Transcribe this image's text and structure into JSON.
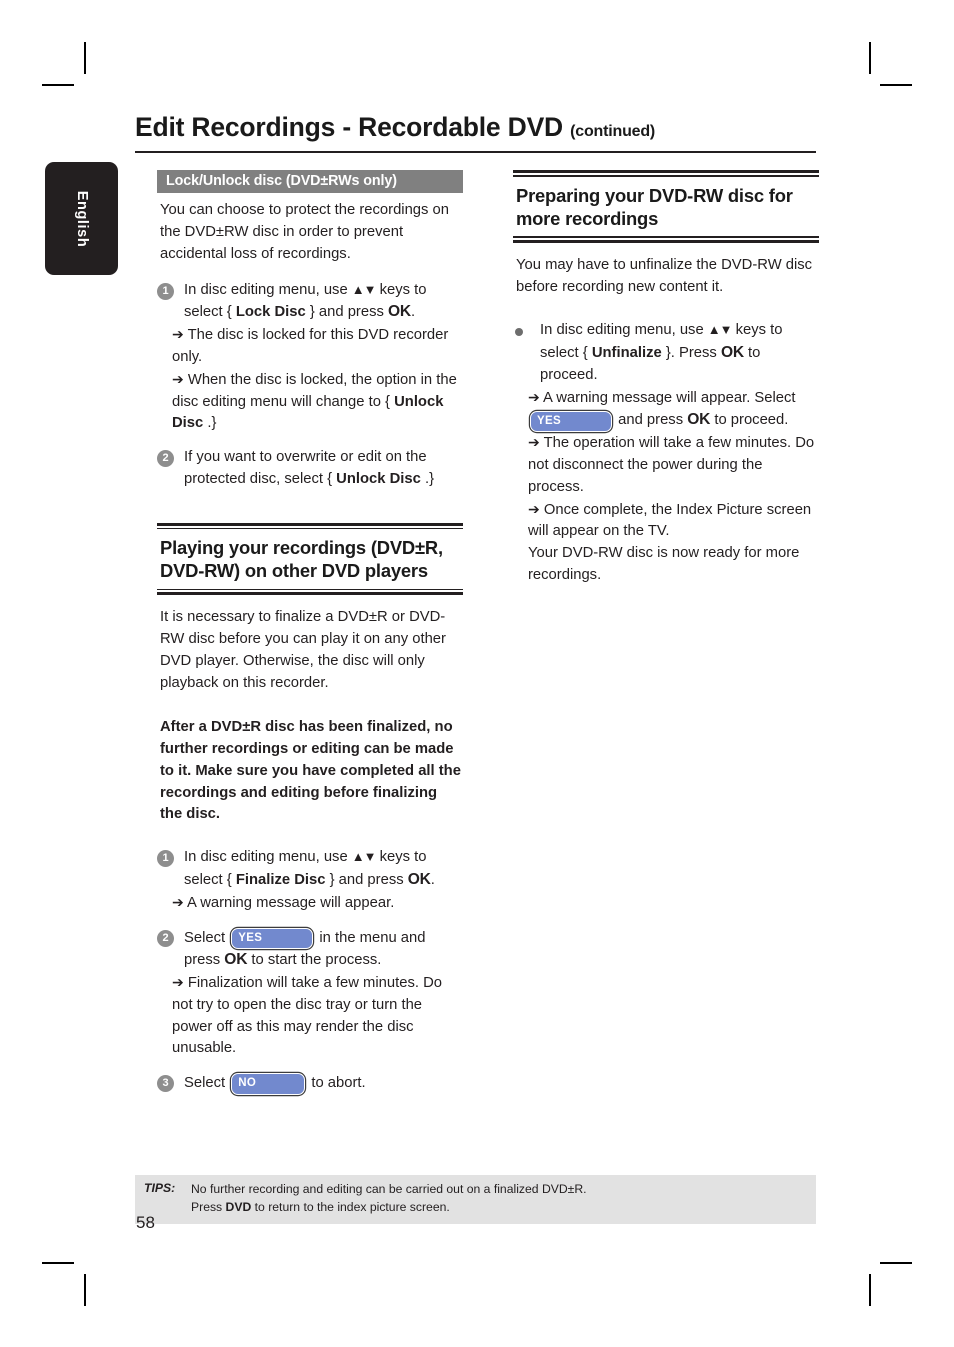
{
  "page": {
    "number": "58",
    "title_main": "Edit Recordings - Recordable DVD",
    "title_suffix": "(continued)",
    "language_tab": "English"
  },
  "left_column": {
    "bar_heading": "Lock/Unlock disc (DVD±RWs only)",
    "intro": "You can choose to protect the recordings on the DVD±RW disc in order to prevent accidental loss of recordings.",
    "steps": [
      {
        "marker": "1",
        "line1_a": "In disc editing menu, use ",
        "line1_keys": "▲▼",
        "line1_b": " keys to select { ",
        "line1_bold": "Lock Disc",
        "line1_c": " } and press ",
        "line1_ok": "OK",
        "line1_d": ".",
        "sub1": "The disc is locked for this DVD recorder only.",
        "sub2_a": "When the disc is locked, the option in the disc editing menu will change to { ",
        "sub2_bold": "Unlock Disc",
        "sub2_b": " .}"
      },
      {
        "marker": "2",
        "text_a": "If you want to overwrite or edit on the protected disc, select { ",
        "text_bold": "Unlock Disc",
        "text_b": " .}"
      }
    ],
    "section2": {
      "heading": "Playing your recordings (DVD±R, DVD-RW) on other DVD players",
      "intro": "It is necessary to finalize a DVD±R or DVD-RW disc before you can play it on any other DVD player. Otherwise, the disc will only playback on this recorder.",
      "warning": "After a DVD±R disc has been finalized, no further recordings or editing can be made to it. Make sure you have completed all the recordings and editing before finalizing the disc.",
      "steps": [
        {
          "marker": "1",
          "line1_a": "In disc editing menu, use ",
          "line1_keys": "▲▼",
          "line1_b": " keys to select { ",
          "line1_bold": "Finalize Disc",
          "line1_c": " } and press ",
          "line1_ok": "OK",
          "line1_d": ".",
          "sub1": "A warning message will appear."
        },
        {
          "marker": "2",
          "pre": "Select ",
          "button": "YES",
          "mid": " in the menu and press ",
          "ok": "OK",
          "post": " to start the process.",
          "sub1": "Finalization will take a few minutes. Do not try to open the disc tray or turn the power off as this may render the disc unusable."
        },
        {
          "marker": "3",
          "pre": "Select ",
          "button": "NO",
          "post": " to abort."
        }
      ]
    }
  },
  "right_column": {
    "heading": "Preparing your DVD-RW disc for more recordings",
    "intro": "You may have to unfinalize the DVD-RW disc before recording new content it.",
    "bullet": {
      "line1_a": "In disc editing menu, use ",
      "line1_keys": "▲▼",
      "line1_b": " keys to select { ",
      "line1_bold": "Unfinalize",
      "line1_c": " }. Press ",
      "line1_ok": "OK",
      "line1_d": " to proceed.",
      "sub1_pre": "A warning message will appear. Select ",
      "sub1_button": "YES",
      "sub1_mid": " and press ",
      "sub1_ok": "OK",
      "sub1_post": " to proceed.",
      "sub2": "The operation will take a few minutes. Do not disconnect the power during the process.",
      "sub3": "Once complete, the Index Picture screen will appear on the TV.",
      "tail": "Your DVD-RW disc is now ready for more recordings."
    }
  },
  "tips": {
    "label": "TIPS:",
    "line1": "No further recording and editing can be carried out on a finalized DVD±R.",
    "line2_pre": "Press ",
    "line2_bold": "DVD",
    "line2_post": " to return to the index picture screen."
  },
  "icons": {
    "arrow": "➔",
    "up_down_keys": "▲▼"
  },
  "colors": {
    "bar_gray": "#808080",
    "tab_black": "#231f20",
    "button_blue": "#7289ce",
    "tips_gray": "#e2e2e2",
    "marker_gray": "#8e8e8e"
  }
}
